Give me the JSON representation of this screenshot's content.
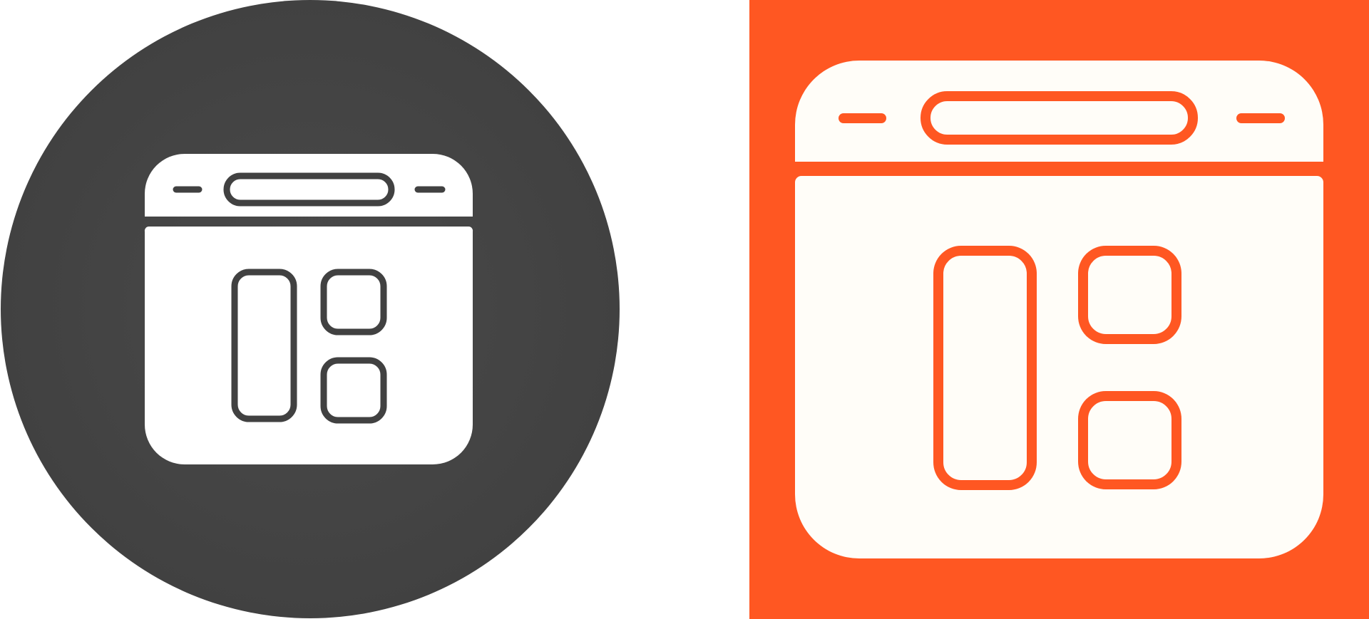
{
  "icons": [
    {
      "name": "browser-layout-icon",
      "style": "glyph-on-dark-circle",
      "background_color": "#414141",
      "background_highlight_color": "#4a4a4a",
      "icon_fill_color": "#ffffff",
      "icon_line_color": "#414141"
    },
    {
      "name": "browser-layout-icon",
      "style": "glyph-on-orange-square",
      "background_color": "#ff5722",
      "icon_fill_color": "#fffdf8",
      "icon_line_color": "#ff5722"
    }
  ]
}
